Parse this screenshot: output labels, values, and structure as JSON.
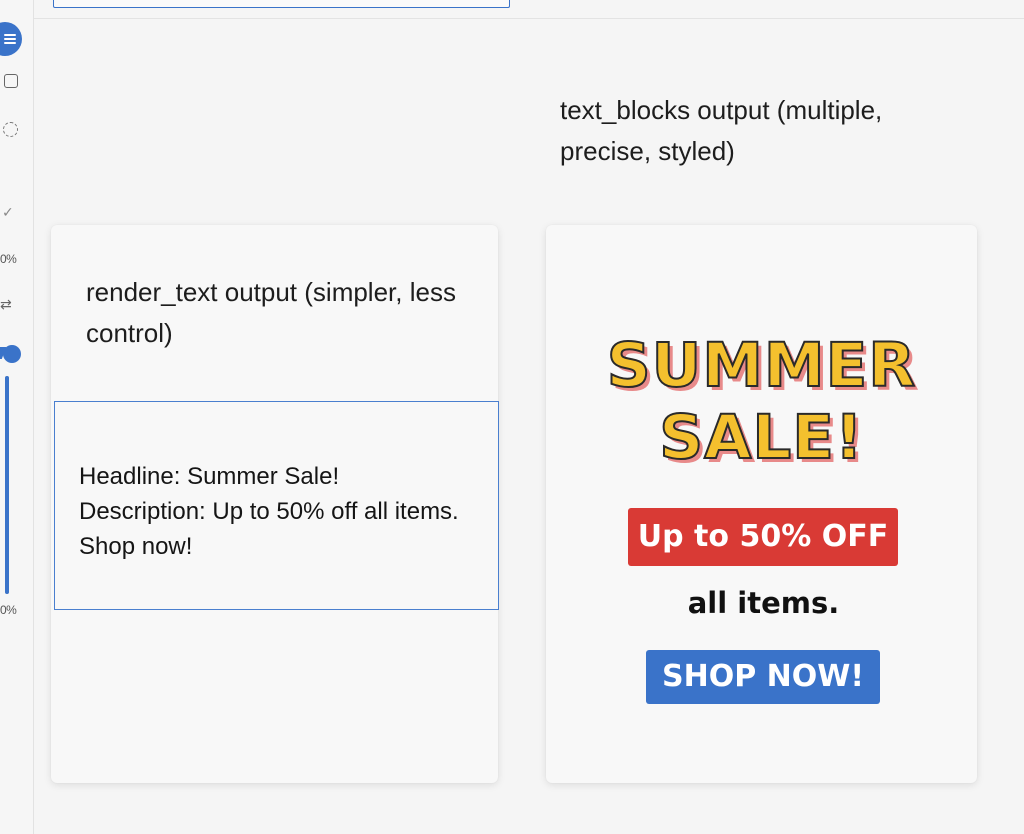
{
  "toolbar": {
    "icons": [
      "menu-icon",
      "rectangle-icon",
      "lasso-icon",
      "check-icon",
      "swap-icon"
    ],
    "upper_percent_label": "0%",
    "lower_percent_label": "0%",
    "slider_fill_fraction": 1.0
  },
  "captions": {
    "right": "text_blocks output (multiple, precise, styled)",
    "left": "render_text output (simpler, less control)"
  },
  "plain_output": {
    "line1": "Headline: Summer Sale!",
    "line2": "Description: Up to 50% off all items.",
    "line3": "Shop now!"
  },
  "styled_output": {
    "title_line1": "SUMMER",
    "title_line2": "SALE!",
    "offer_badge": "Up to 50% OFF",
    "subtext": "all items.",
    "cta_button": "SHOP NOW!"
  },
  "colors": {
    "accent_blue": "#3a73c9",
    "badge_red": "#d93a35",
    "title_yellow": "#f4c02e",
    "title_shadow": "#e88a8a"
  }
}
